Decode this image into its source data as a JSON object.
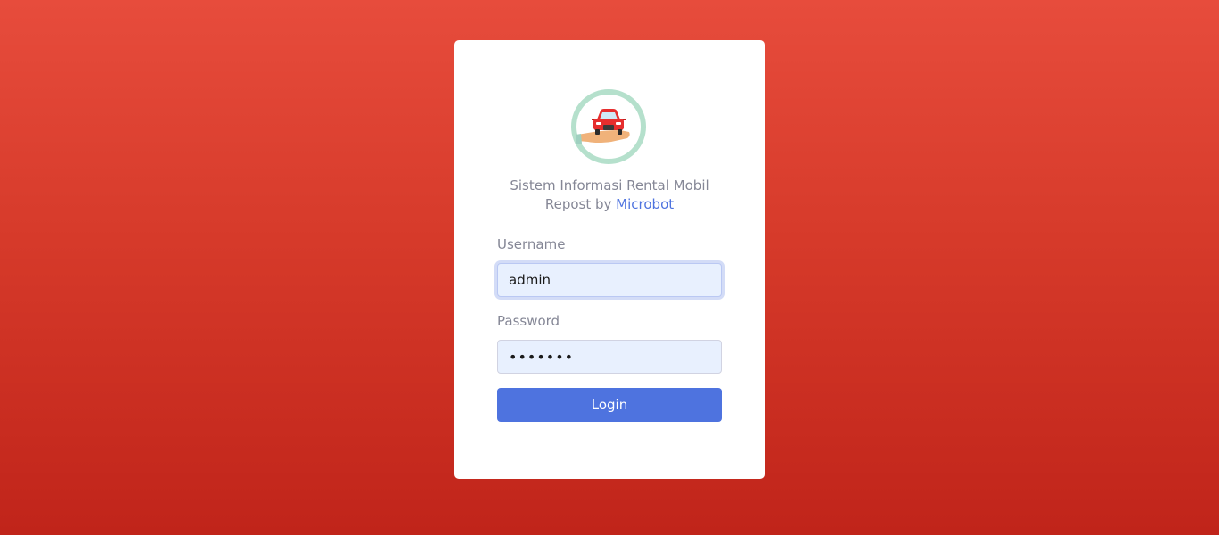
{
  "app": {
    "title_line1": "Sistem Informasi Rental Mobil",
    "credit_prefix": "Repost by ",
    "credit_link": "Microbot"
  },
  "form": {
    "username_label": "Username",
    "username_value": "admin",
    "password_label": "Password",
    "password_value": "•••••••",
    "login_label": "Login"
  },
  "colors": {
    "background_top": "#e74c3c",
    "background_bottom": "#c0241a",
    "primary": "#4e73df",
    "text_muted": "#858796",
    "input_bg": "#e8f0fe"
  },
  "icons": {
    "logo": "car-rental-logo-icon"
  }
}
